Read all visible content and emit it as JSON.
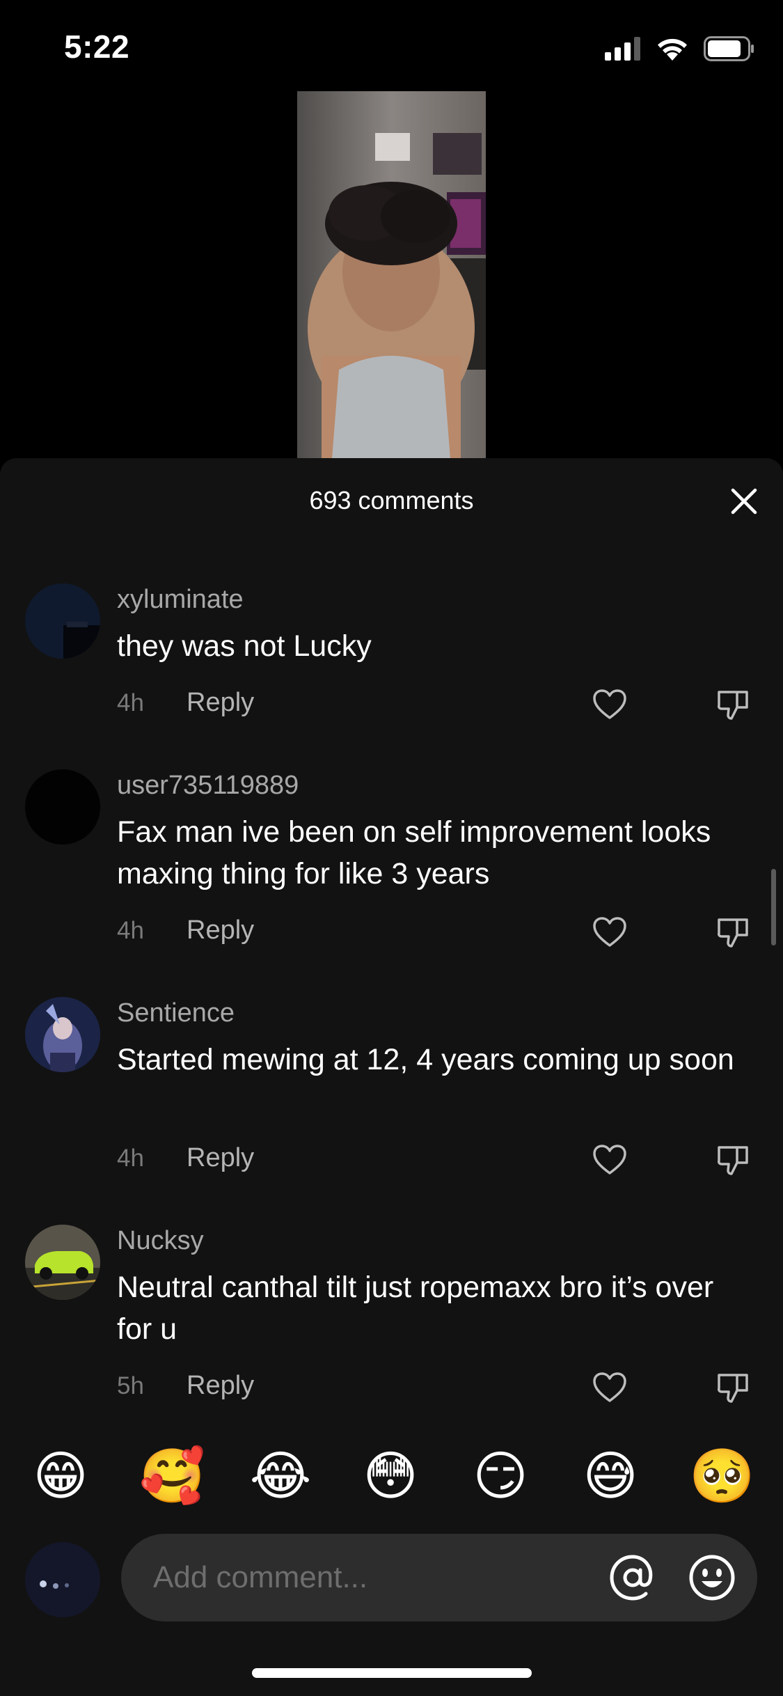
{
  "status_bar": {
    "time": "5:22"
  },
  "sheet": {
    "comment_count_label": "693 comments"
  },
  "comments": [
    {
      "username": "xyluminate",
      "text": "they was not Lucky",
      "time": "4h",
      "reply_label": "Reply"
    },
    {
      "username": "user735119889",
      "text": "Fax man ive been on self improvement looks maxing thing for like 3 years",
      "time": "4h",
      "reply_label": "Reply"
    },
    {
      "username": "Sentience",
      "text": "Started mewing at 12, 4 years coming up soon",
      "time": "4h",
      "reply_label": "Reply"
    },
    {
      "username": "Nucksy",
      "text": "Neutral canthal tilt just ropemaxx bro it’s over for u",
      "time": "5h",
      "reply_label": "Reply"
    }
  ],
  "emoji_bar": [
    "😁",
    "🥰",
    "😂",
    "😳",
    "😏",
    "😅",
    "🥺"
  ],
  "input": {
    "placeholder": "Add comment..."
  },
  "icons": {
    "close": "close-icon",
    "like": "heart-outline-icon",
    "dislike": "thumbs-down-icon",
    "mention": "at-sign-icon",
    "emoji": "smiley-icon"
  },
  "colors": {
    "sheet_bg": "#121212",
    "input_bg": "#2d2d2d",
    "username": "#a8a8a8",
    "meta": "#7a7a7a"
  }
}
